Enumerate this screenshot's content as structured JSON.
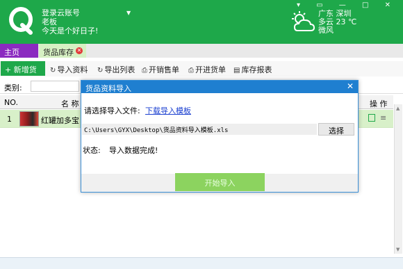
{
  "header": {
    "account_lines": [
      "登录云账号",
      "老板",
      "今天是个好日子!"
    ],
    "weather": {
      "location": "广东  深圳",
      "condition": "多云  23 ℃",
      "wind": "微风"
    },
    "window_controls": "▾ ▭ — □ ✕"
  },
  "tabs": [
    {
      "label": "主页"
    },
    {
      "label": "货品库存",
      "close": "✕"
    }
  ],
  "toolbar": {
    "new_label": "+ 新增货品",
    "items": [
      {
        "label": "导入资料",
        "icon": "↻"
      },
      {
        "label": "导出列表",
        "icon": "↻"
      },
      {
        "label": "开销售单",
        "icon": "⎙"
      },
      {
        "label": "开进货单",
        "icon": "⎙"
      },
      {
        "label": "库存报表",
        "icon": "▤"
      }
    ]
  },
  "filter": {
    "category_label": "类别:"
  },
  "table": {
    "headers": [
      "NO.",
      "名 称",
      "操 作"
    ],
    "rows": [
      {
        "no": "1",
        "name": "红罐加多宝"
      }
    ]
  },
  "dialog": {
    "title": "货品资料导入",
    "close": "✕",
    "select_label": "请选择导入文件:",
    "download_link": "下载导入模板",
    "file_path": "C:\\Users\\GYX\\Desktop\\货品资料导入模板.xls",
    "choose_button": "选择",
    "status_label": "状态:",
    "status_value": "导入数据完成!",
    "start_button": "开始导入"
  },
  "colors": {
    "brand_green": "#1ea84a",
    "tab_purple": "#8b2bc0",
    "dialog_blue": "#1f7fd0"
  }
}
